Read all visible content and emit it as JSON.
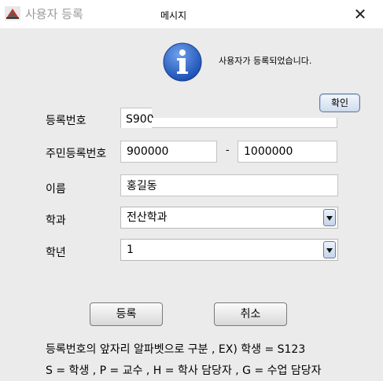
{
  "window": {
    "app_title": "사용자 등록",
    "dialog_title": "메시지",
    "close_icon": "close-icon",
    "app_icon": "java-app-icon"
  },
  "dialog": {
    "icon": "info-icon",
    "message": "사용자가 등록되었습니다.",
    "ok_label": "확인"
  },
  "form": {
    "reg_no_label": "등록번호",
    "reg_no_value": "S900",
    "rrn_label": "주민등록번호",
    "rrn_front": "900000",
    "rrn_separator": "-",
    "rrn_back": "1000000",
    "name_label": "이름",
    "name_value": "홍길동",
    "dept_label": "학과",
    "dept_value": "전산학과",
    "year_label": "학년",
    "year_value": "1"
  },
  "buttons": {
    "register": "등록",
    "cancel": "취소"
  },
  "notes": {
    "line1": "등록번호의 앞자리 알파벳으로 구분 , EX) 학생 = S123",
    "line2": "S = 학생 , P = 교수 , H = 학사 담당자 , G = 수업 담당자"
  }
}
